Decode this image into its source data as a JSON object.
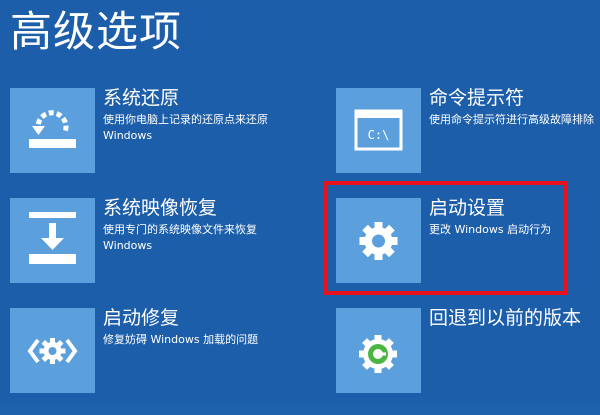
{
  "page": {
    "title": "高级选项"
  },
  "options": {
    "system_restore": {
      "title": "系统还原",
      "desc": "使用你电脑上记录的还原点来还原 Windows",
      "icon": "restore-icon"
    },
    "command_prompt": {
      "title": "命令提示符",
      "desc": "使用命令提示符进行高级故障排除",
      "icon": "command-prompt-icon",
      "icon_text": "C:\\"
    },
    "image_recovery": {
      "title": "系统映像恢复",
      "desc": "使用专门的系统映像文件来恢复 Windows",
      "icon": "image-recovery-icon"
    },
    "startup_settings": {
      "title": "启动设置",
      "desc": "更改 Windows 启动行为",
      "icon": "gear-icon"
    },
    "startup_repair": {
      "title": "启动修复",
      "desc": "修复妨碍 Windows 加载的问题",
      "icon": "startup-repair-icon"
    },
    "go_back": {
      "title": "回退到以前的版本",
      "icon": "go-back-icon"
    }
  },
  "colors": {
    "background": "#1c5ea9",
    "tile": "#5ba0dc",
    "highlight": "#e8121c",
    "logo_green": "#4bb543"
  }
}
